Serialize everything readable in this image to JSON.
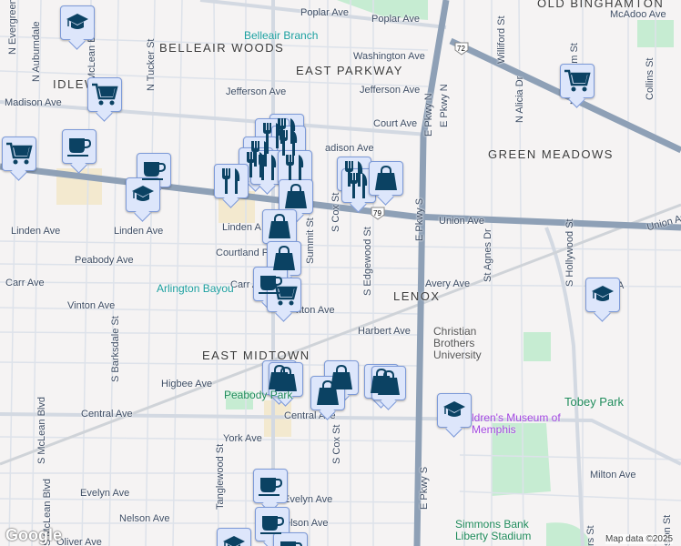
{
  "neighborhoods": [
    "BELLEAIR WOODS",
    "EAST PARKWAY",
    "IDLEWILD",
    "GREEN MEADOWS",
    "LENOX",
    "EAST MIDTOWN",
    "OLD BINGHAMTON"
  ],
  "streets": [
    "Poplar Ave",
    "Poplar Ave",
    "Washington Ave",
    "Jefferson Ave",
    "Jefferson Ave",
    "Court Ave",
    "Madison Ave",
    "adison Ave",
    "Union Ave",
    "Union Ave",
    "Linden Ave",
    "Linden Ave",
    "Linden A",
    "Courtland P",
    "Peabody Ave",
    "Carr Ave",
    "Carr A",
    "Vinton Ave",
    "nton Ave",
    "Avery Ave",
    "Harbert Ave",
    "Higbee Ave",
    "Central Ave",
    "Central Ave",
    "York Ave",
    "Evelyn Ave",
    "Evelyn Ave",
    "Nelson Ave",
    "elson Ave",
    "Oliver Ave",
    "Milton Ave",
    "McAdoo Ave",
    "N Evergreen",
    "N Auburndale",
    "N McLean Blvd",
    "N Tucker St",
    "S McLean Blvd",
    "S McLean Blvd",
    "S Barksdale St",
    "Tanglewood St",
    "S Cox St",
    "S Cox St",
    "Summit St",
    "S Edgewood St",
    "E Pkwy S",
    "E Pkwy S",
    "E Pkwy N",
    "E Pkwy N",
    "St Agnes Dr",
    "S Hollywood St",
    "N Alicia Dr",
    "N Bingham St",
    "Collins St",
    "Williford St",
    "rs St",
    "ston St",
    "A"
  ],
  "pois": {
    "library": "Belleair Branch",
    "park1": "Arlington Bayou",
    "park2": "Peabody Park",
    "university": "Christian Brothers University",
    "park3": "Tobey Park",
    "museum": "ldren's Museum of Memphis",
    "stadium": "Simmons Bank Liberty Stadium"
  },
  "shields": [
    "79",
    "72"
  ],
  "markers": [
    "school",
    "cart",
    "cart",
    "coffee",
    "coffee",
    "school",
    "food",
    "food",
    "food",
    "food",
    "food",
    "food",
    "food",
    "food",
    "bag",
    "bag",
    "bag",
    "coffee",
    "cart",
    "food",
    "food",
    "bag",
    "cart",
    "school",
    "bag",
    "bag",
    "bag",
    "bag",
    "bag",
    "bag",
    "school",
    "coffee",
    "coffee",
    "school",
    "coffee"
  ],
  "footer": {
    "logo": "Google",
    "copyright": "Map data ©2025"
  },
  "colors": {
    "marker_icon": "#0b4263",
    "park": "#c6ecd2",
    "poi_green": "#1e8a5a",
    "museum": "#a347e0"
  }
}
